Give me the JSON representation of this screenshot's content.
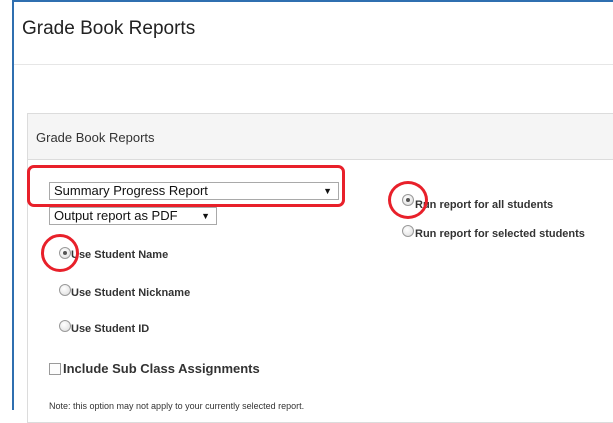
{
  "page": {
    "title": "Grade Book Reports"
  },
  "panel": {
    "title": "Grade Book Reports"
  },
  "report_select": {
    "value": "Summary Progress Report",
    "arrow": "▼"
  },
  "output_select": {
    "value": "Output report as PDF",
    "arrow": "▼"
  },
  "name_options": [
    {
      "label": "Use Student Name",
      "checked": true
    },
    {
      "label": "Use Student Nickname",
      "checked": false
    },
    {
      "label": "Use Student ID",
      "checked": false
    }
  ],
  "run_options": [
    {
      "label": "Run report for all students",
      "checked": true
    },
    {
      "label": "Run report for selected students",
      "checked": false
    }
  ],
  "include_sub": {
    "label": "Include Sub Class Assignments",
    "checked": false
  },
  "note": "Note: this option may not apply to your currently selected report.",
  "colors": {
    "border_blue": "#2f6fb0",
    "highlight_red": "#e8202a"
  }
}
